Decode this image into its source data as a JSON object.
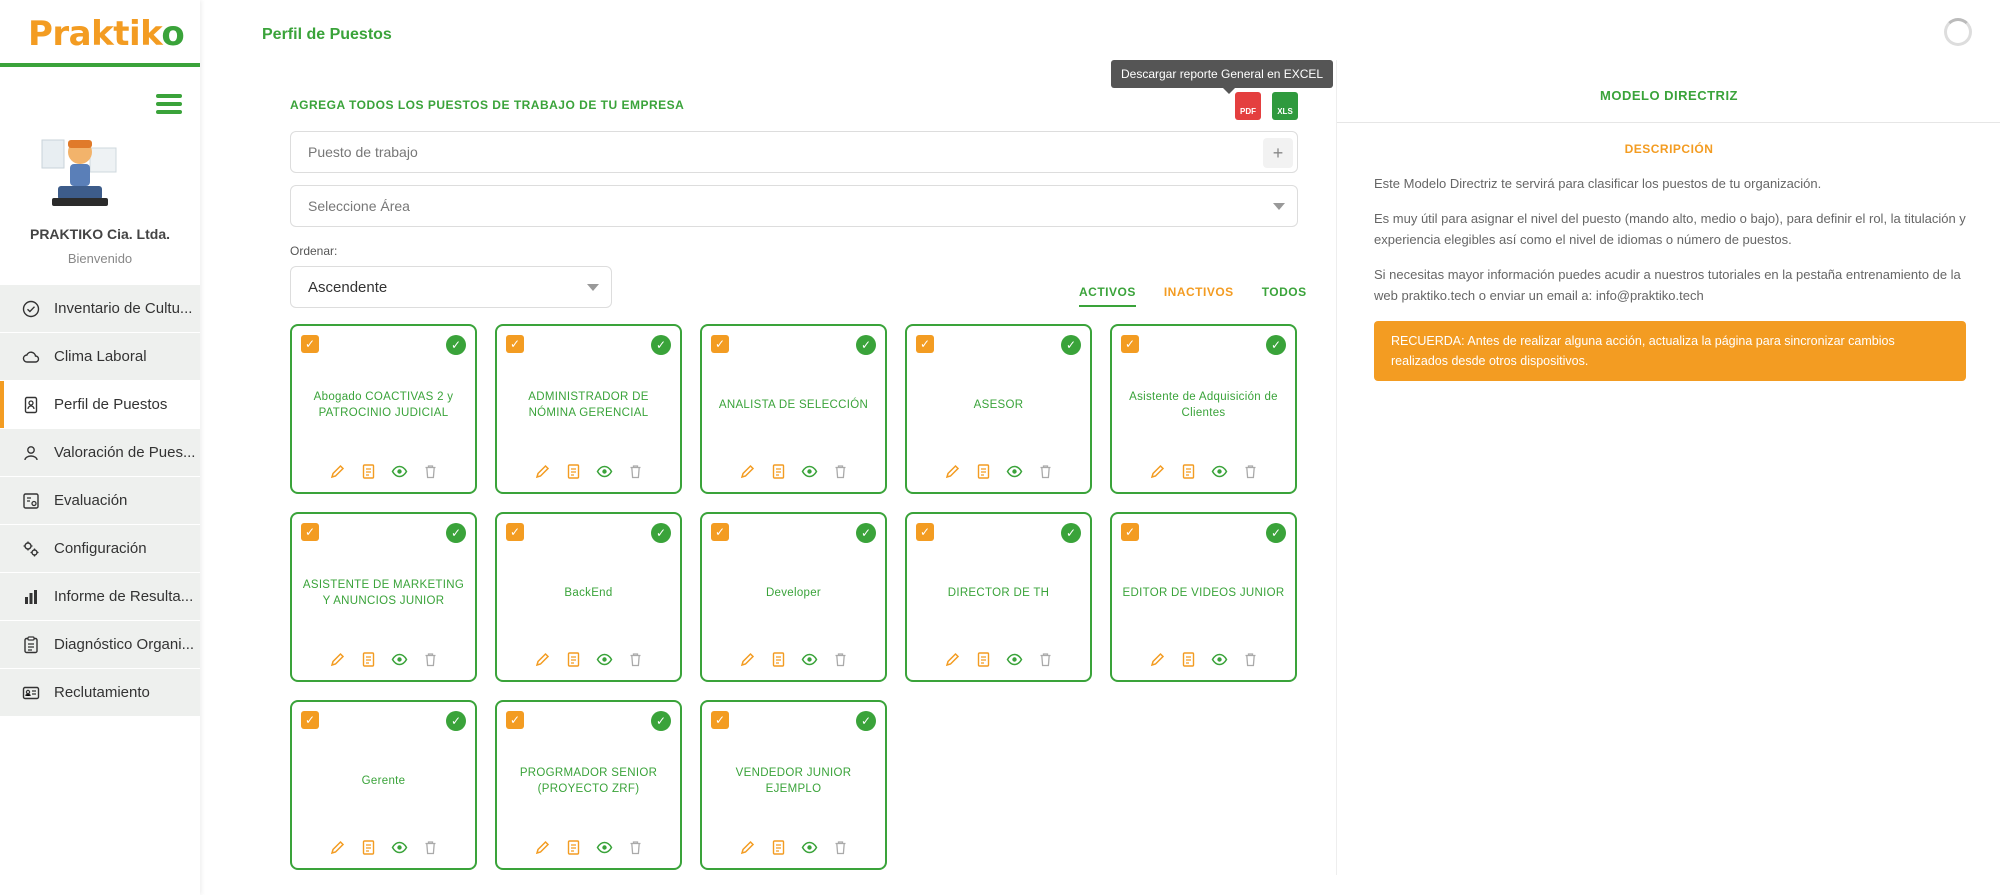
{
  "app": {
    "logo_text_1": "Praktik",
    "logo_text_2": "o"
  },
  "sidebar": {
    "company": "PRAKTIKO Cia. Ltda.",
    "welcome": "Bienvenido",
    "items": [
      {
        "label": "Inventario de Cultu...",
        "icon": "check-circle-icon"
      },
      {
        "label": "Clima Laboral",
        "icon": "cloud-icon"
      },
      {
        "label": "Perfil de Puestos",
        "icon": "id-badge-icon",
        "active": true
      },
      {
        "label": "Valoración de Pues...",
        "icon": "user-icon"
      },
      {
        "label": "Evaluación",
        "icon": "evaluation-icon"
      },
      {
        "label": "Configuración",
        "icon": "gears-icon"
      },
      {
        "label": "Informe de Resulta...",
        "icon": "bar-chart-icon"
      },
      {
        "label": "Diagnóstico Organi...",
        "icon": "clipboard-icon"
      },
      {
        "label": "Reclutamiento",
        "icon": "id-card-icon"
      }
    ]
  },
  "header": {
    "page_title": "Perfil de Puestos"
  },
  "main": {
    "section_heading": "AGREGA TODOS LOS PUESTOS DE TRABAJO DE TU EMPRESA",
    "tooltip": "Descargar reporte General en EXCEL",
    "pdf_label": "PDF",
    "xls_label": "XLS",
    "job_input_placeholder": "Puesto de trabajo",
    "area_select_placeholder": "Seleccione Área",
    "order_label": "Ordenar:",
    "order_value": "Ascendente",
    "tabs": [
      "ACTIVOS",
      "INACTIVOS",
      "TODOS"
    ],
    "cards": [
      "Abogado COACTIVAS 2 y PATROCINIO JUDICIAL",
      "ADMINISTRADOR DE NÓMINA GERENCIAL",
      "ANALISTA DE SELECCIÓN",
      "ASESOR",
      "Asistente de Adquisición de Clientes",
      "ASISTENTE DE MARKETING Y ANUNCIOS JUNIOR",
      "BackEnd",
      "Developer",
      "DIRECTOR DE TH",
      "EDITOR DE VIDEOS JUNIOR",
      "Gerente",
      "PROGRMADOR SENIOR (PROYECTO ZRF)",
      "VENDEDOR JUNIOR EJEMPLO"
    ]
  },
  "right_panel": {
    "title": "MODELO DIRECTRIZ",
    "subtitle": "DESCRIPCIÓN",
    "p1": "Este Modelo Directriz te servirá para clasificar los puestos de tu organización.",
    "p2": "Es muy útil para asignar el nivel del puesto (mando alto, medio o bajo), para definir el rol, la titulación y experiencia elegibles así como el nivel de idiomas o número de puestos.",
    "p3": "Si necesitas mayor información puedes acudir a nuestros tutoriales en la pestaña entrenamiento de la web praktiko.tech o enviar un email a: info@praktiko.tech",
    "notice": "RECUERDA: Antes de realizar alguna acción, actualiza la página para sincronizar cambios realizados desde otros dispositivos."
  },
  "colors": {
    "brand_green": "#3aa33a",
    "brand_orange": "#f39c22",
    "pdf_red": "#e43f3f",
    "xls_green": "#2f9a3e"
  }
}
